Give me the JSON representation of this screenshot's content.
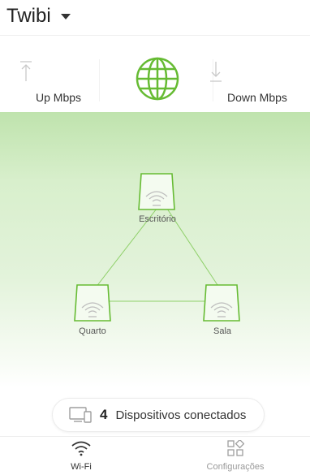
{
  "header": {
    "title": "Twibi",
    "caret_icon": "caret-down-icon"
  },
  "speed": {
    "up_label": "Up Mbps",
    "down_label": "Down Mbps",
    "up_icon": "upload-arrow-icon",
    "down_icon": "download-arrow-icon",
    "globe_icon": "globe-icon"
  },
  "network": {
    "nodes": [
      {
        "label": "Escritório"
      },
      {
        "label": "Quarto"
      },
      {
        "label": "Sala"
      }
    ],
    "node_icon": "router-wifi-icon"
  },
  "devices": {
    "count": "4",
    "text": "Dispositivos conectados",
    "icon": "devices-icon"
  },
  "nav": {
    "tabs": [
      {
        "label": "Wi-Fi",
        "icon": "wifi-icon",
        "active": true
      },
      {
        "label": "Configurações",
        "icon": "settings-grid-icon",
        "active": false
      }
    ]
  },
  "colors": {
    "accent": "#66bb33",
    "green_bg": "#cfe9c0",
    "text": "#222222",
    "muted": "#999999"
  }
}
